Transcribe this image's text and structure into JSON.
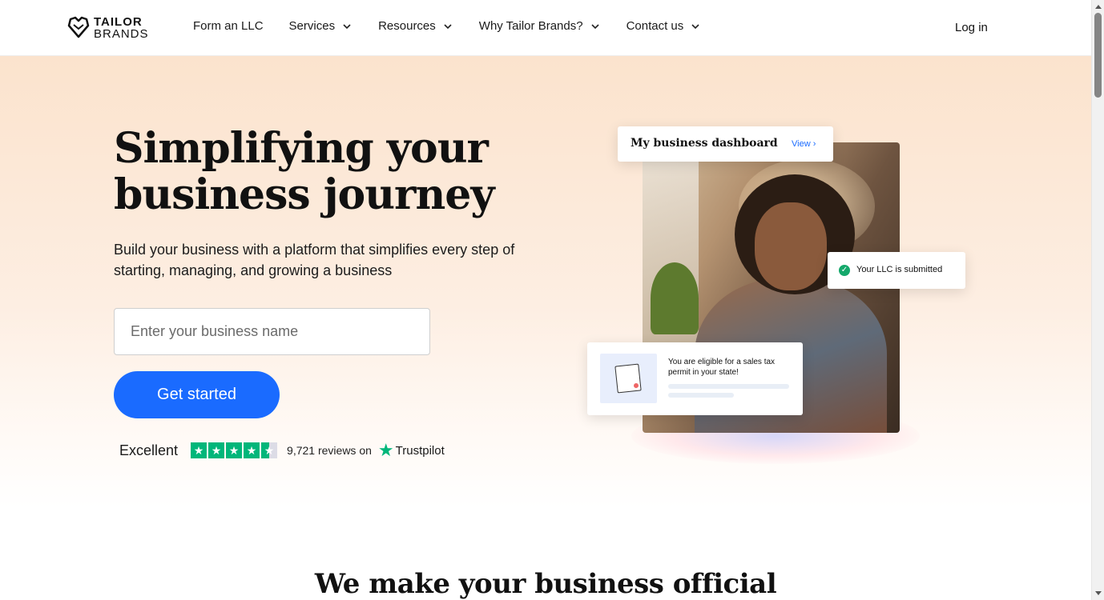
{
  "brand": {
    "line1": "TAILOR",
    "line2": "BRANDS"
  },
  "nav": {
    "items": [
      {
        "label": "Form an LLC",
        "dropdown": false
      },
      {
        "label": "Services",
        "dropdown": true
      },
      {
        "label": "Resources",
        "dropdown": true
      },
      {
        "label": "Why Tailor Brands?",
        "dropdown": true
      },
      {
        "label": "Contact us",
        "dropdown": true
      }
    ],
    "login_label": "Log in"
  },
  "hero": {
    "title": "Simplifying your business journey",
    "subtitle": "Build your business with a platform that simplifies every step of starting, managing, and growing a business",
    "input_placeholder": "Enter your business name",
    "cta_label": "Get started",
    "trustpilot": {
      "rating_label": "Excellent",
      "reviews": "9,721 reviews on",
      "brand": "Trustpilot",
      "stars": 4.5
    }
  },
  "cards": {
    "dashboard_title": "My business dashboard",
    "dashboard_view": "View",
    "llc_status": "Your LLC is submitted",
    "tax_message": "You are eligible for a sales tax permit in your state!"
  },
  "next_section": {
    "title": "We make your business official"
  },
  "colors": {
    "accent": "#1a6bff",
    "trustpilot_green": "#00b67a",
    "success": "#14a86b"
  }
}
